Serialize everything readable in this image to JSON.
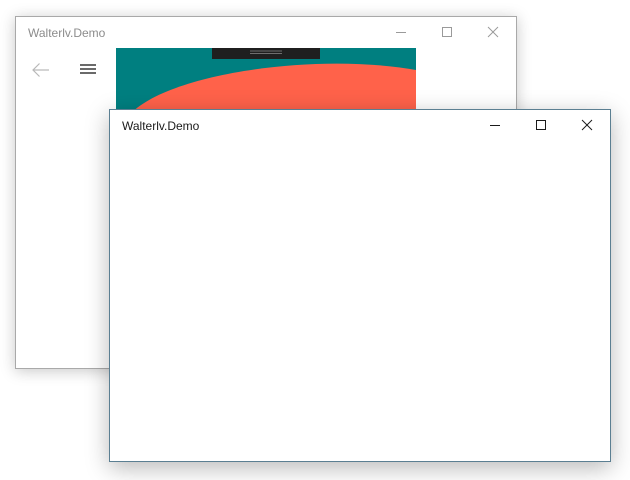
{
  "back_window": {
    "title": "Walterlv.Demo",
    "caption_buttons": {
      "minimize_icon": "minimize-icon",
      "maximize_icon": "maximize-icon",
      "close_icon": "close-icon"
    },
    "nav": {
      "back_icon": "arrow-left-icon",
      "menu_icon": "hamburger-icon"
    },
    "colors": {
      "teal": "#007f80",
      "coral": "#ff624a",
      "handle": "#1f1f1f"
    }
  },
  "front_window": {
    "title": "Walterlv.Demo",
    "caption_buttons": {
      "minimize_icon": "minimize-icon",
      "maximize_icon": "maximize-icon",
      "close_icon": "close-icon"
    },
    "colors": {
      "border": "#5b7f92"
    }
  }
}
